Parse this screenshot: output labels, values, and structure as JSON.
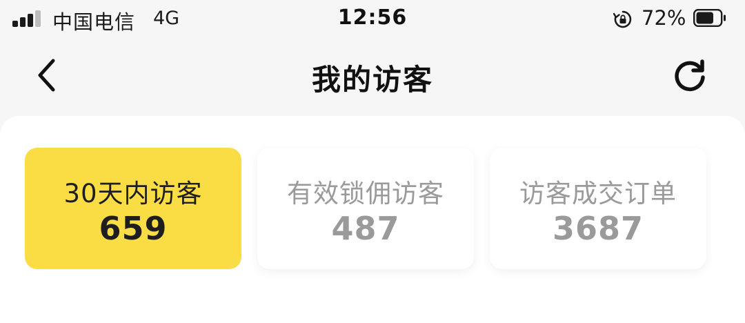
{
  "status_bar": {
    "carrier": "中国电信",
    "network": "4G",
    "time": "12:56",
    "battery_percent": "72%",
    "battery_level": 0.72,
    "icons": [
      "signal-icon",
      "rotation-lock-icon",
      "battery-icon"
    ]
  },
  "nav": {
    "title": "我的访客",
    "back_icon": "chevron-left-icon",
    "refresh_icon": "refresh-icon"
  },
  "stats": [
    {
      "label": "30天内访客",
      "value": "659",
      "selected": true
    },
    {
      "label": "有效锁佣访客",
      "value": "487",
      "selected": false
    },
    {
      "label": "访客成交订单",
      "value": "3687",
      "selected": false
    }
  ],
  "colors": {
    "accent": "#fadd45",
    "text_dark": "#1e1e1e",
    "text_muted": "#9a9a9a",
    "background": "#f6f6f6",
    "panel": "#ffffff"
  }
}
